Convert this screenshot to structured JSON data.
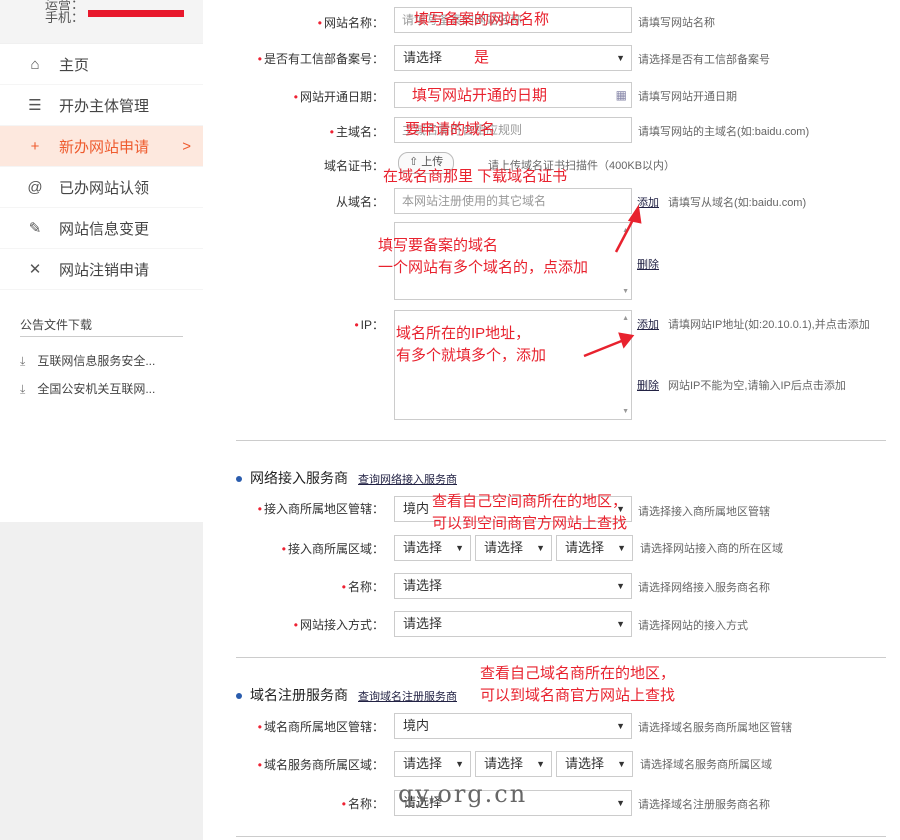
{
  "sidebar": {
    "user_label_partial": "运营：",
    "phone_label": "手机：",
    "menu": [
      {
        "icon": "home-icon",
        "glyph": "⌂",
        "label": "主页"
      },
      {
        "icon": "list-icon",
        "glyph": "☰",
        "label": "开办主体管理"
      },
      {
        "icon": "plus-icon",
        "glyph": "+",
        "label": "新办网站申请",
        "active": true,
        "arrow": ">"
      },
      {
        "icon": "at-icon",
        "glyph": "@",
        "label": "已办网站认领"
      },
      {
        "icon": "edit-icon",
        "glyph": "✎",
        "label": "网站信息变更"
      },
      {
        "icon": "close-icon",
        "glyph": "✕",
        "label": "网站注销申请"
      }
    ],
    "downloads": {
      "title": "公告文件下载",
      "items": [
        "互联网信息服务安全...",
        "全国公安机关互联网..."
      ]
    }
  },
  "form": {
    "site_name": {
      "label": "网站名称：",
      "placeholder": "请填写备案的网站名称",
      "hint": "请填写网站名称"
    },
    "icp": {
      "label": "是否有工信部备案号：",
      "value": "请选择",
      "hint": "请选择是否有工信部备案号"
    },
    "open_date": {
      "label": "网站开通日期：",
      "hint": "请填写网站开通日期"
    },
    "main_domain": {
      "label": "主域名：",
      "placeholder": "主域名需符合相应规则",
      "hint": "请填写网站的主域名(如:baidu.com)"
    },
    "domain_cert": {
      "label": "域名证书：",
      "button": "上传",
      "hint": "请上传域名证书扫描件（400KB以内）"
    },
    "sub_domain": {
      "label": "从域名：",
      "placeholder": "本网站注册使用的其它域名",
      "add": "添加",
      "hint": "请填写从域名(如:baidu.com)",
      "delete": "删除"
    },
    "ip": {
      "label": "IP：",
      "add": "添加",
      "hint": "请填网站IP地址(如:20.10.0.1),并点击添加",
      "delete": "删除",
      "delete_hint": "网站IP不能为空,请输入IP后点击添加"
    }
  },
  "access": {
    "title": "网络接入服务商",
    "query_link": "查询网络接入服务商",
    "region_mgmt": {
      "label": "接入商所属地区管辖：",
      "value": "境内",
      "hint": "请选择接入商所属地区管辖"
    },
    "region": {
      "label": "接入商所属区域：",
      "values": [
        "请选择",
        "请选择",
        "请选择"
      ],
      "hint": "请选择网站接入商的所在区域"
    },
    "name": {
      "label": "名称：",
      "value": "请选择",
      "hint": "请选择网络接入服务商名称"
    },
    "method": {
      "label": "网站接入方式：",
      "value": "请选择",
      "hint": "请选择网站的接入方式"
    }
  },
  "registrar": {
    "title": "域名注册服务商",
    "query_link": "查询域名注册服务商",
    "region_mgmt": {
      "label": "域名商所属地区管辖：",
      "value": "境内",
      "hint": "请选择域名服务商所属地区管辖"
    },
    "region": {
      "label": "域名服务商所属区域：",
      "values": [
        "请选择",
        "请选择",
        "请选择"
      ],
      "hint": "请选择域名服务商所属区域"
    },
    "name": {
      "label": "名称：",
      "value": "请选择",
      "hint": "请选择域名注册服务商名称"
    }
  },
  "annotations": {
    "site_name": "填写备案的网站名称",
    "icp": "是",
    "open_date": "填写网站开通的日期",
    "main_domain": "要申请的域名",
    "cert": "在域名商那里 下载域名证书",
    "sub_domain_1": "填写要备案的域名",
    "sub_domain_2": "一个网站有多个域名的，点添加",
    "ip_1": "域名所在的IP地址，",
    "ip_2": "有多个就填多个，添加",
    "access_1": "查看自己空间商所在的地区，",
    "access_2": "可以到空间商官方网站上查找",
    "registrar_1": "查看自己域名商所在的地区，",
    "registrar_2": "可以到域名商官方网站上查找"
  },
  "watermark": "qy.org.cn",
  "req_mark": "•"
}
